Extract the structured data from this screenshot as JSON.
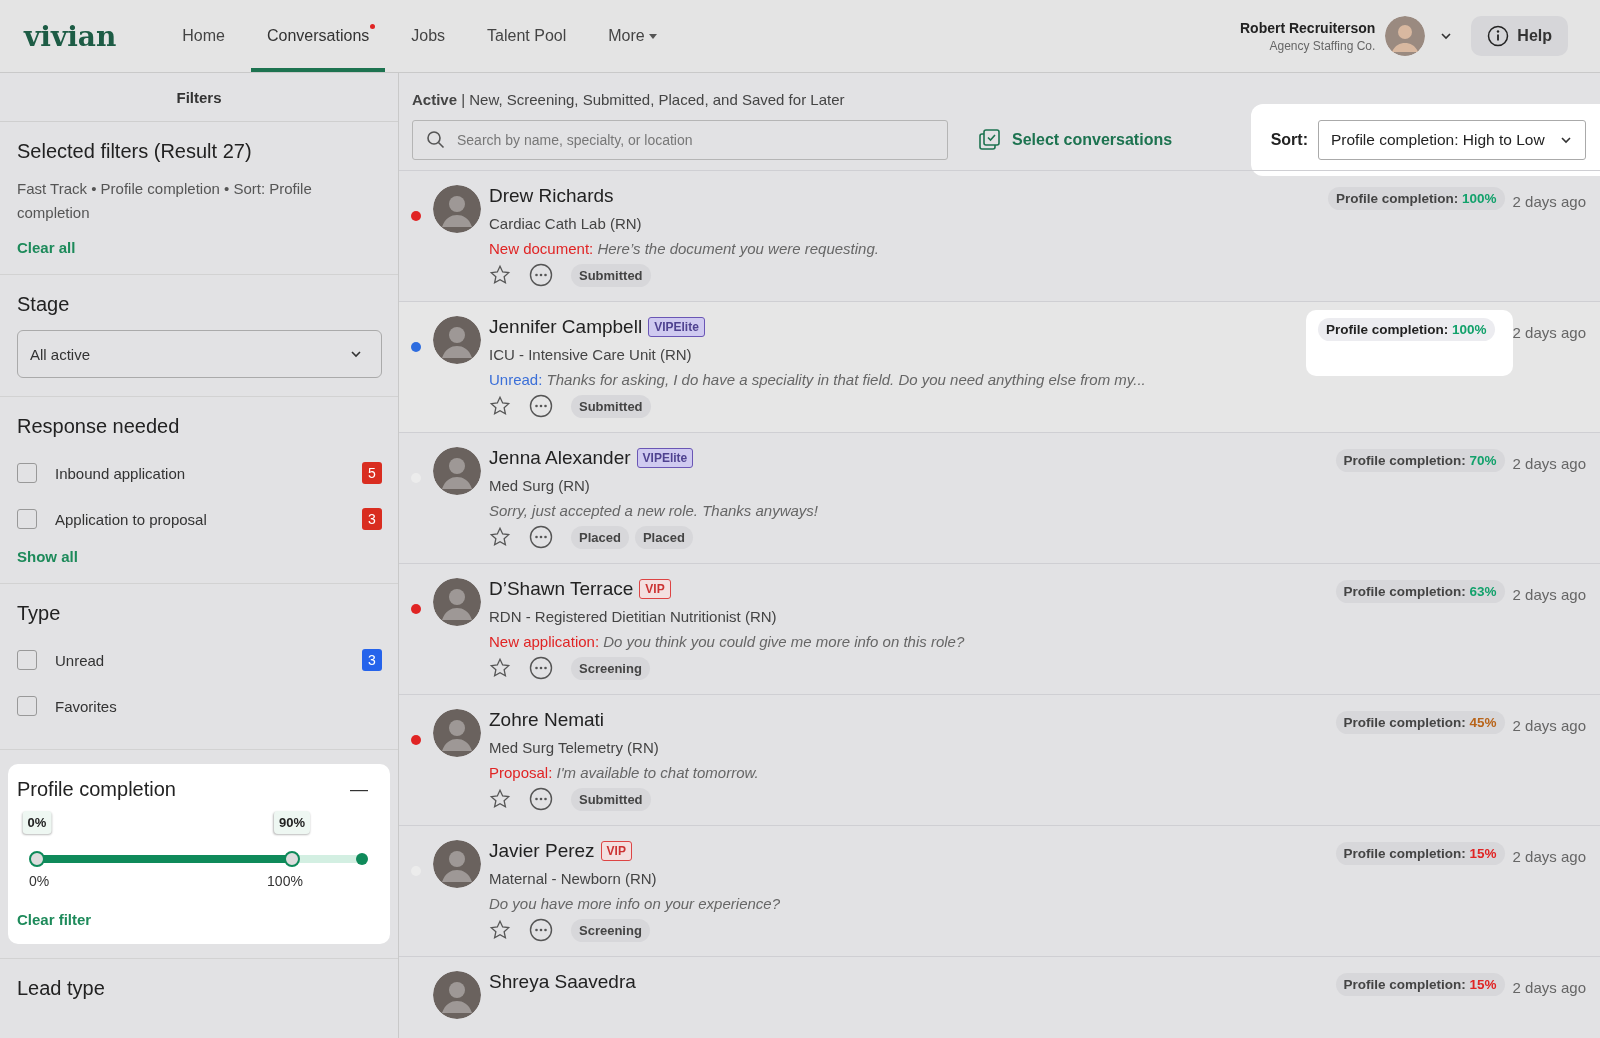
{
  "header": {
    "logo": "vivian",
    "nav": [
      {
        "label": "Home",
        "selected": false,
        "notification": false,
        "has_menu": false
      },
      {
        "label": "Conversations",
        "selected": true,
        "notification": true,
        "has_menu": false
      },
      {
        "label": "Jobs",
        "selected": false,
        "notification": false,
        "has_menu": false
      },
      {
        "label": "Talent Pool",
        "selected": false,
        "notification": false,
        "has_menu": false
      },
      {
        "label": "More",
        "selected": false,
        "notification": false,
        "has_menu": true
      }
    ],
    "user": {
      "name": "Robert Recruiterson",
      "company": "Agency Staffing Co."
    },
    "help": "Help"
  },
  "sidebar": {
    "title": "Filters",
    "selected_filters": {
      "title": "Selected filters (Result 27)",
      "summary": "Fast Track  •  Profile completion •  Sort: Profile completion",
      "clear": "Clear all"
    },
    "stage": {
      "title": "Stage",
      "value": "All active"
    },
    "response_needed": {
      "title": "Response needed",
      "items": [
        {
          "label": "Inbound application",
          "checked": false,
          "count": "5",
          "color": "#d92d20"
        },
        {
          "label": "Application to proposal",
          "checked": false,
          "count": "3",
          "color": "#d92d20"
        }
      ],
      "show_all": "Show all"
    },
    "type": {
      "title": "Type",
      "items": [
        {
          "label": "Unread",
          "checked": false,
          "count": "3",
          "color": "#2563eb"
        },
        {
          "label": "Favorites",
          "checked": false
        }
      ]
    },
    "profile_completion": {
      "title": "Profile completion",
      "highlighted": true,
      "collapse": "—",
      "low": {
        "label": "0%",
        "level": 0,
        "axis": "0%"
      },
      "high": {
        "label": "90%",
        "level": 0.785,
        "axis": "100%"
      },
      "clear": "Clear filter"
    },
    "lead_type": {
      "title": "Lead type"
    }
  },
  "main": {
    "status": "**Active** | New, Screening, Submitted, Placed, and Saved for Later",
    "search": {
      "placeholder": "Search by name, specialty, or location"
    },
    "select": "Select conversations",
    "sort": {
      "label": "Sort:",
      "value": "Profile completion: High to Low",
      "highlighted": true
    },
    "conversations": [
      {
        "name": "Drew Richards",
        "specialty": "Cardiac Cath Lab (RN)",
        "prefix": {
          "text": "New document:",
          "color": "#e02424"
        },
        "message": "Here’s the document you were requesting.",
        "tags": [
          "Submitted"
        ],
        "completion": {
          "label": "Profile completion:",
          "value": "100%",
          "color": "#12a16b",
          "highlighted": false
        },
        "time": "2 days ago",
        "color": "#e02424"
      },
      {
        "name": "Jennifer Campbell",
        "badge": {
          "text": "VIPElite",
          "kind": "vip_elite"
        },
        "specialty": "ICU - Intensive Care Unit (RN)",
        "prefix": {
          "text": "Unread:",
          "color": "#3b6fd8"
        },
        "message": "Thanks for asking, I do have a speciality in that field. Do you need anything else from my...",
        "tags": [
          "Submitted"
        ],
        "completion": {
          "label": "Profile completion:",
          "value": "100%",
          "color": "#12a16b",
          "highlighted": true
        },
        "time": "2 days ago",
        "color": "#2d6cdf"
      },
      {
        "name": "Jenna Alexander",
        "badge": {
          "text": "VIPElite",
          "kind": "vip_elite"
        },
        "specialty": "Med Surg (RN)",
        "message": "Sorry, just accepted a new role. Thanks anyways!",
        "tags": [
          "Placed",
          "Placed"
        ],
        "completion": {
          "label": "Profile completion:",
          "value": "70%",
          "color": "#12a16b",
          "highlighted": false
        },
        "time": "2 days ago",
        "color": "#ececec"
      },
      {
        "name": "D’Shawn Terrace",
        "badge": {
          "text": "VIP",
          "kind": "vip"
        },
        "specialty": "RDN - Registered Dietitian Nutritionist (RN)",
        "prefix": {
          "text": "New application:",
          "color": "#e02424"
        },
        "message": "Do you think you could give me more info on this role?",
        "tags": [
          "Screening"
        ],
        "completion": {
          "label": "Profile completion:",
          "value": "63%",
          "color": "#12a16b",
          "highlighted": false
        },
        "time": "2 days ago",
        "color": "#e02424"
      },
      {
        "name": "Zohre Nemati",
        "specialty": "Med Surg Telemetry (RN)",
        "prefix": {
          "text": "Proposal:",
          "color": "#e02424"
        },
        "message": "I'm available to chat tomorrow.",
        "tags": [
          "Submitted"
        ],
        "completion": {
          "label": "Profile completion:",
          "value": "45%",
          "color": "#b8641a",
          "highlighted": false
        },
        "time": "2 days ago",
        "color": "#e02424"
      },
      {
        "name": "Javier Perez",
        "badge": {
          "text": "VIP",
          "kind": "vip"
        },
        "specialty": "Maternal - Newborn (RN)",
        "message": "Do you have more info on your experience?",
        "tags": [
          "Screening"
        ],
        "completion": {
          "label": "Profile completion:",
          "value": "15%",
          "color": "#e02424",
          "highlighted": false
        },
        "time": "2 days ago",
        "color": "#ececec"
      },
      {
        "name": "Shreya Saavedra",
        "completion": {
          "label": "Profile completion:",
          "value": "15%",
          "color": "#e02424",
          "highlighted": false
        },
        "time": "2 days ago"
      }
    ]
  }
}
